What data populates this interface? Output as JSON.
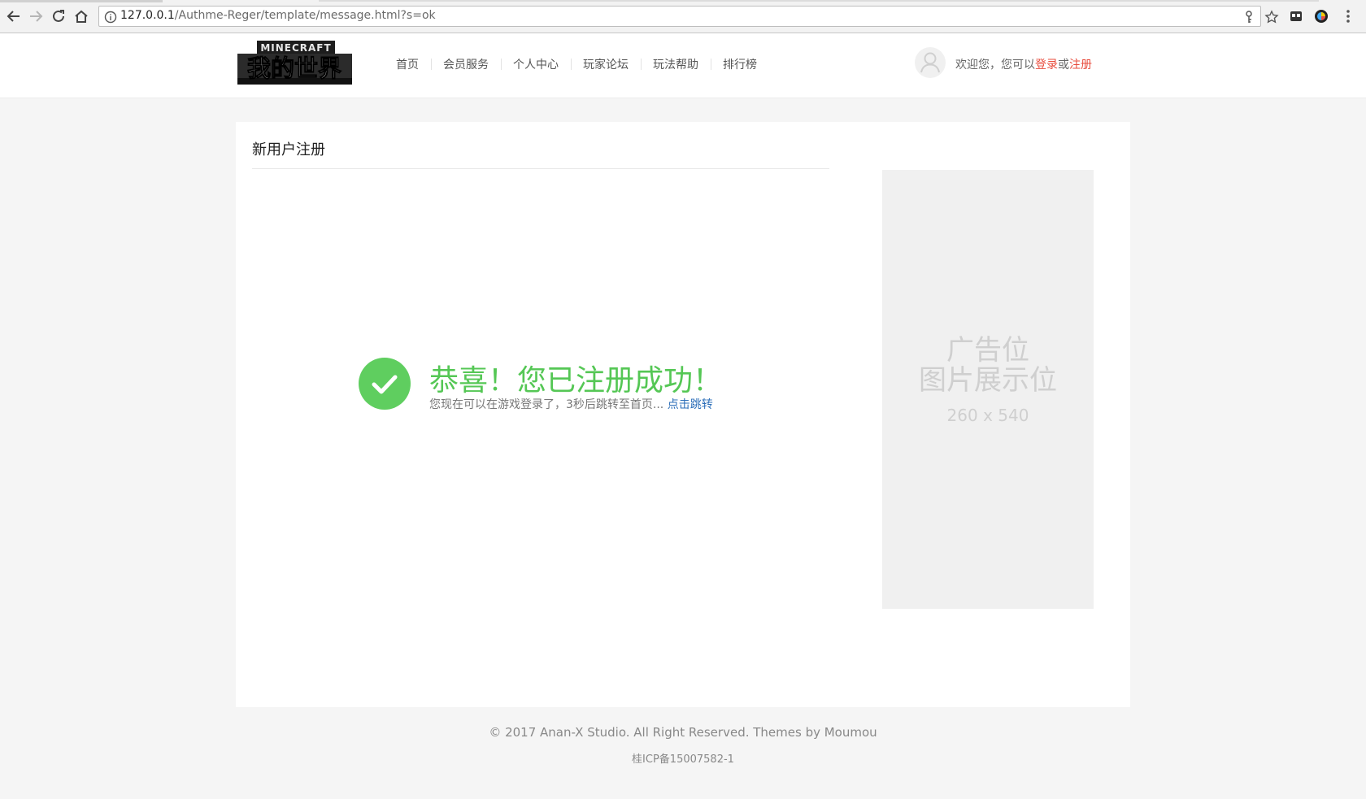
{
  "browser": {
    "url_host": "127.0.0.1",
    "url_path": "/Authme-Reger/template/message.html?s=ok"
  },
  "header": {
    "logo_alt": "MINECRAFT 我的世界",
    "nav": [
      "首页",
      "会员服务",
      "个人中心",
      "玩家论坛",
      "玩法帮助",
      "排行榜"
    ],
    "welcome_prefix": "欢迎您，您可以",
    "login_label": "登录",
    "or_label": "或",
    "register_label": "注册"
  },
  "main": {
    "title": "新用户注册",
    "success_title": "恭喜！您已注册成功！",
    "success_text": "您现在可以在游戏登录了，3秒后跳转至首页... ",
    "jump_link": "点击跳转",
    "ad_line1": "广告位",
    "ad_line2": "图片展示位",
    "ad_size": "260 x 540"
  },
  "footer": {
    "copyright": "© 2017 Anan-X Studio. All Right Reserved. Themes by Moumou",
    "icp": "桂ICP备15007582-1"
  },
  "colors": {
    "success_green": "#55c755",
    "link_blue": "#2a6db8",
    "accent_red": "#e84c3d"
  }
}
